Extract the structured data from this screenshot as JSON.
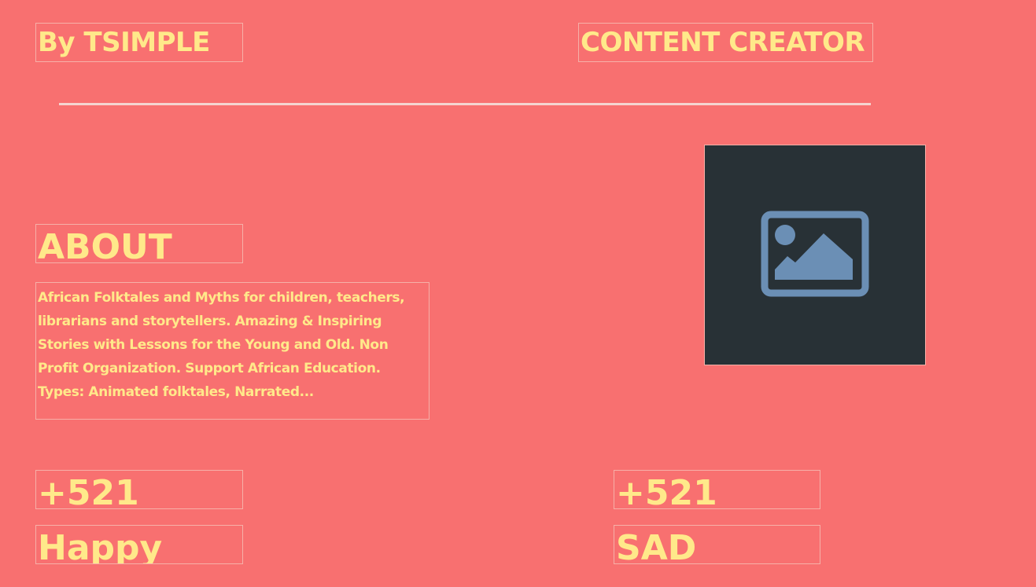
{
  "header": {
    "author": "By TSIMPLE",
    "role": "CONTENT CREATOR"
  },
  "about": {
    "heading": "ABOUT",
    "description": "African Folktales and Myths for children, teachers, librarians and storytellers. Amazing & Inspiring Stories with Lessons for the Young and Old. Non Profit Organization. Support African Education. Types: Animated folktales, Narrated..."
  },
  "profile_image": {
    "icon": "image-placeholder-icon"
  },
  "stats": {
    "happy": {
      "count": "+521",
      "label": "Happy"
    },
    "sad": {
      "count": "+521",
      "label": "SAD"
    }
  },
  "colors": {
    "background": "#F87070",
    "text": "#FFE98A",
    "border": "#F6B0A8",
    "image_bg": "#283136",
    "icon": "#6B8FB5"
  }
}
